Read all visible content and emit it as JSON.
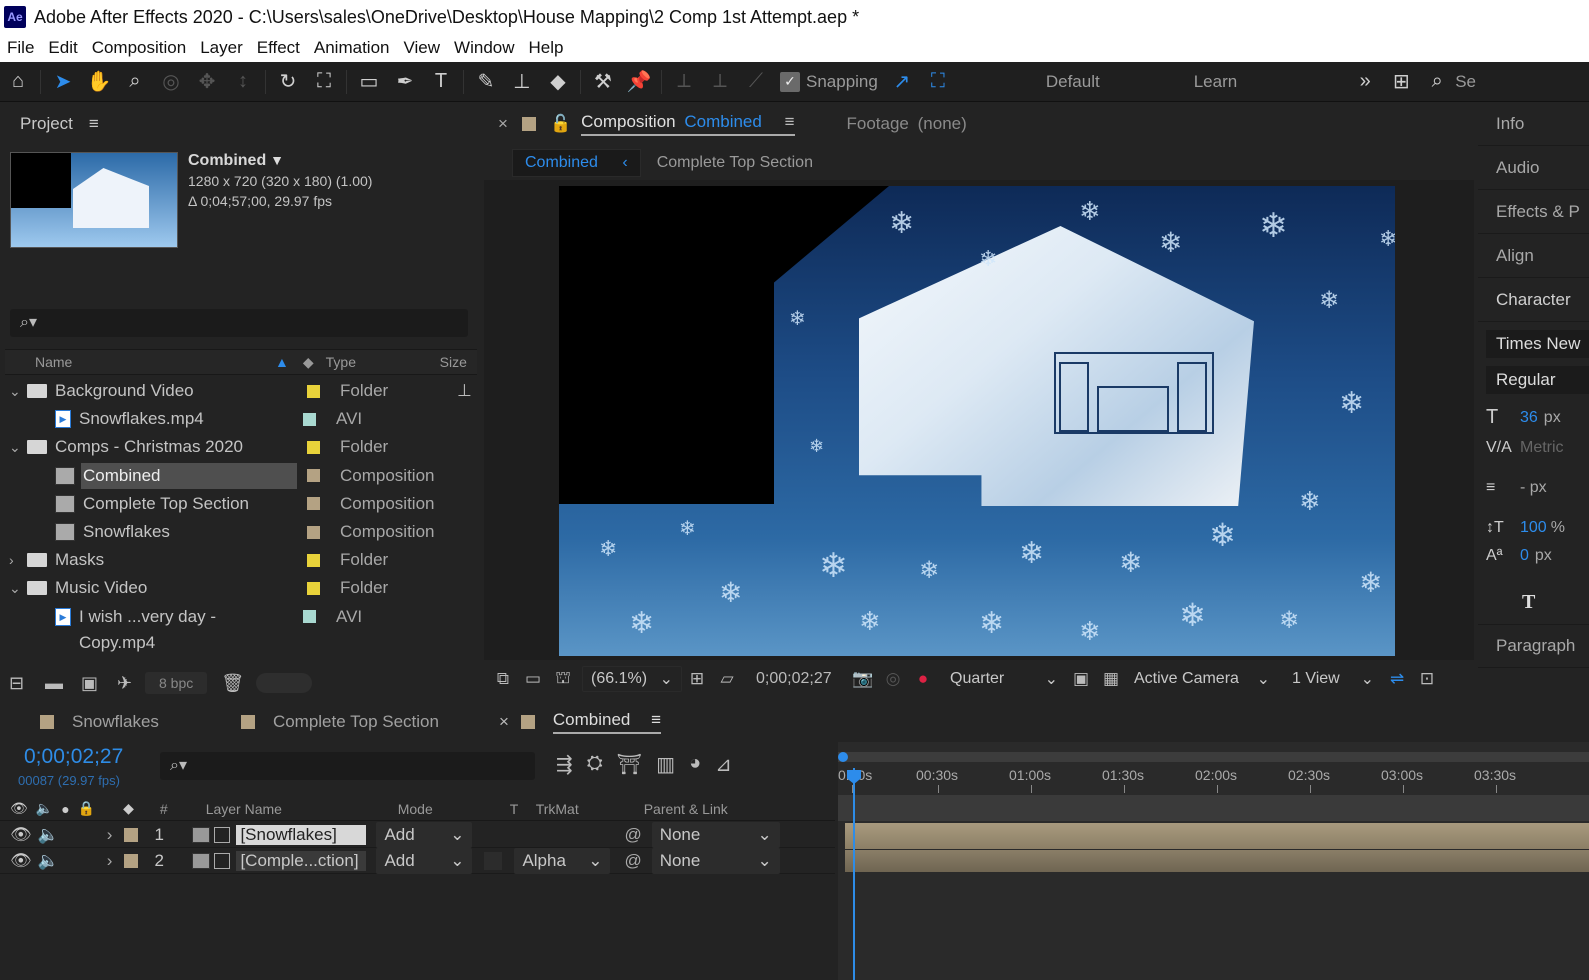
{
  "window": {
    "title": "Adobe After Effects 2020 - C:\\Users\\sales\\OneDrive\\Desktop\\House Mapping\\2 Comp 1st Attempt.aep *",
    "logo": "Ae"
  },
  "menu": [
    "File",
    "Edit",
    "Composition",
    "Layer",
    "Effect",
    "Animation",
    "View",
    "Window",
    "Help"
  ],
  "toolbar": {
    "snapping_label": "Snapping",
    "workspace_default": "Default",
    "workspace_learn": "Learn",
    "search_short": "Se"
  },
  "project": {
    "panel_title": "Project",
    "selected": {
      "name": "Combined",
      "dimensions": "1280 x 720  (320 x 180) (1.00)",
      "duration": "Δ 0;04;57;00, 29.97 fps"
    },
    "columns": {
      "name": "Name",
      "type": "Type",
      "size": "Size"
    },
    "items": [
      {
        "name": "Background Video",
        "type": "Folder",
        "kind": "folder",
        "label_color": "#e8d23a"
      },
      {
        "name": "Snowflakes.mp4",
        "type": "AVI",
        "kind": "avi",
        "label_color": "#a8d8d0"
      },
      {
        "name": "Comps - Christmas 2020",
        "type": "Folder",
        "kind": "folder",
        "label_color": "#e8d23a"
      },
      {
        "name": "Combined",
        "type": "Composition",
        "kind": "comp",
        "label_color": "#b4a283"
      },
      {
        "name": "Complete Top Section",
        "type": "Composition",
        "kind": "comp",
        "label_color": "#b4a283"
      },
      {
        "name": "Snowflakes",
        "type": "Composition",
        "kind": "comp",
        "label_color": "#b4a283"
      },
      {
        "name": "Masks",
        "type": "Folder",
        "kind": "folder",
        "label_color": "#e8d23a"
      },
      {
        "name": "Music Video",
        "type": "Folder",
        "kind": "folder",
        "label_color": "#e8d23a"
      },
      {
        "name": "I wish ...very day - Copy.mp4",
        "type": "AVI",
        "kind": "avi",
        "label_color": "#a8d8d0"
      }
    ],
    "bpc": "8 bpc"
  },
  "composition": {
    "tab_prefix": "Composition",
    "tab_name": "Combined",
    "footage_tab": "Footage",
    "footage_value": "(none)",
    "sub_tab_active": "Combined",
    "sub_tab_other": "Complete Top Section",
    "zoom": "(66.1%)",
    "timecode": "0;00;02;27",
    "resolution": "Quarter",
    "camera": "Active Camera",
    "views": "1 View"
  },
  "right_panels": {
    "info": "Info",
    "audio": "Audio",
    "effects": "Effects & P",
    "align": "Align",
    "character": "Character",
    "font": "Times New",
    "style": "Regular",
    "font_size": "36",
    "unit_px": "px",
    "tracking": "Metric",
    "leading": "- px",
    "vscale": "100",
    "vscale_unit": "%",
    "baseline": "0",
    "paragraph": "Paragraph"
  },
  "timeline": {
    "tabs": [
      "Snowflakes",
      "Complete Top Section",
      "Combined"
    ],
    "timecode": "0;00;02;27",
    "frame_info": "00087 (29.97 fps)",
    "columns": {
      "num": "#",
      "layer_name": "Layer Name",
      "mode": "Mode",
      "t": "T",
      "trkmat": "TrkMat",
      "parent": "Parent & Link"
    },
    "layers": [
      {
        "num": "1",
        "name": "[Snowflakes]",
        "mode": "Add",
        "trkmat": "",
        "parent": "None"
      },
      {
        "num": "2",
        "name": "[Comple...ction]",
        "mode": "Add",
        "trkmat": "Alpha",
        "parent": "None"
      }
    ],
    "ruler": [
      "0:00s",
      "00:30s",
      "01:00s",
      "01:30s",
      "02:00s",
      "02:30s",
      "03:00s",
      "03:30s"
    ]
  }
}
